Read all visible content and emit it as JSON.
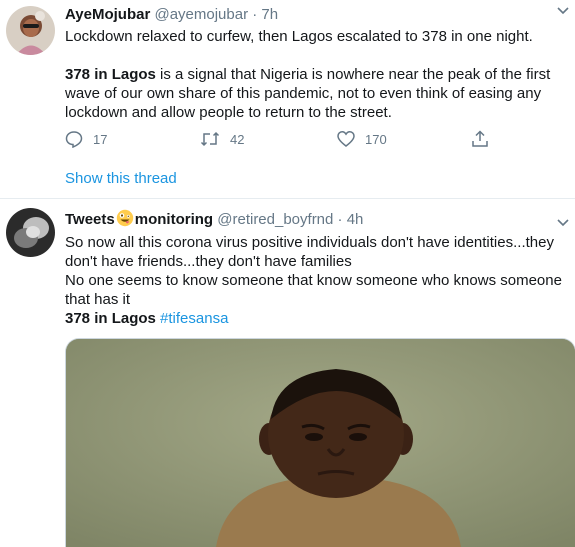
{
  "tweet1": {
    "name": "AyeMojubar",
    "handle": "@ayemojubar",
    "separator": "·",
    "time": "7h",
    "line1": "Lockdown relaxed to curfew, then Lagos escalated to 378 in one night.",
    "bold_lead": "378 in Lagos",
    "line2_rest": " is a signal that Nigeria is nowhere near the peak of the first wave of our own share of this pandemic, not to even think of easing any lockdown and allow people to return to the street.",
    "replies": "17",
    "retweets": "42",
    "likes": "170",
    "show_thread": "Show this thread"
  },
  "tweet2": {
    "name_part1": "Tweets",
    "name_part2": "monitoring",
    "handle": "@retired_boyfrnd",
    "separator": "·",
    "time": "4h",
    "line1": "So now all this corona virus positive individuals don't have identities...they don't have friends...they don't have families",
    "line2": "No one seems to know someone that know someone who knows someone that has it",
    "bold_lead": "378 in Lagos",
    "hashtag": "#tifesansa"
  },
  "icons": {
    "reply": "reply-icon",
    "retweet": "retweet-icon",
    "like": "heart-icon",
    "share": "share-icon",
    "caret": "chevron-down-icon",
    "emoji": "zany-face-emoji"
  },
  "colors": {
    "link": "#1b95e0",
    "secondary": "#657786",
    "divider": "#e6ecf0"
  }
}
